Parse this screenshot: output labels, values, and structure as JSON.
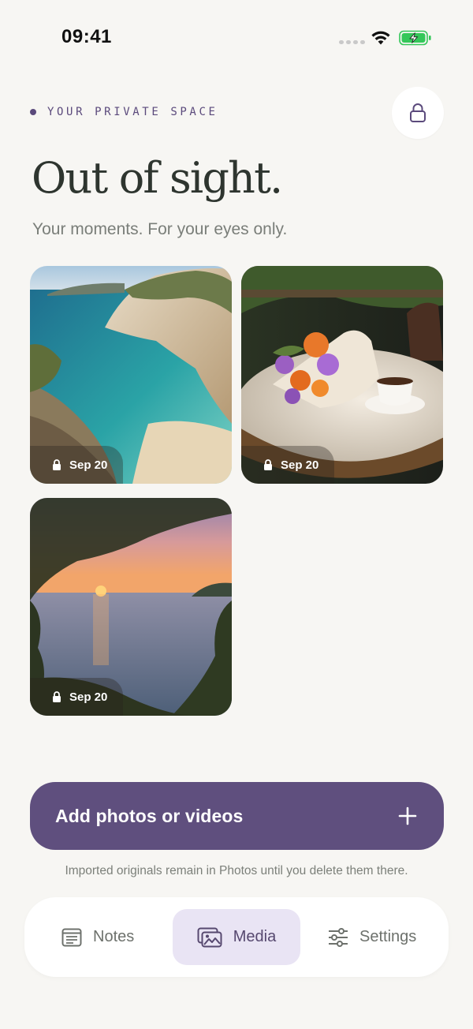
{
  "status_bar": {
    "time": "09:41"
  },
  "header": {
    "eyebrow": "YOUR PRIVATE SPACE",
    "title": "Out of sight.",
    "subtitle": "Your moments. For your eyes only.",
    "lock_icon": "lock-icon"
  },
  "photos": [
    {
      "scene": "coastal-cove",
      "date": "Sep 20",
      "locked": true
    },
    {
      "scene": "flowers-and-coffee",
      "date": "Sep 20",
      "locked": true
    },
    {
      "scene": "sunset-sea",
      "date": "Sep 20",
      "locked": true
    }
  ],
  "add_button": {
    "label": "Add photos or videos",
    "icon": "plus-icon"
  },
  "footnote": "Imported originals remain in Photos until you delete them there.",
  "tabs": [
    {
      "label": "Notes",
      "icon": "notes-icon",
      "selected": false
    },
    {
      "label": "Media",
      "icon": "photos-icon",
      "selected": true
    },
    {
      "label": "Settings",
      "icon": "sliders-icon",
      "selected": false
    }
  ],
  "colors": {
    "accent": "#5f4f7e",
    "background": "#f7f6f3",
    "selected_tab_bg": "#e9e4f4",
    "battery_green": "#34c759"
  }
}
